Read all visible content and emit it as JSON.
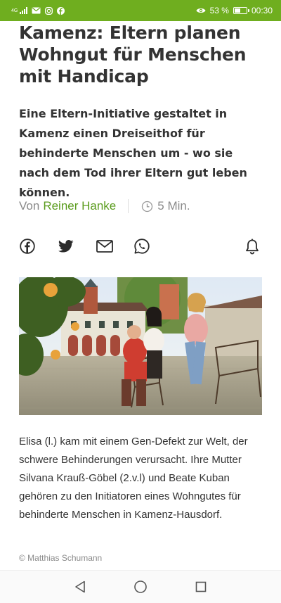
{
  "status_bar": {
    "network": "4G",
    "battery_percent": "53 %",
    "battery_level": 0.53,
    "time": "00:30",
    "icons": [
      "signal-icon",
      "mail-icon",
      "instagram-icon",
      "facebook-icon",
      "eye-icon",
      "battery-icon"
    ]
  },
  "article": {
    "headline": "Kamenz: Eltern planen Wohngut für Menschen mit Handicap",
    "teaser": "Eine Eltern-Initiative gestaltet in Kamenz einen Dreiseithof für behinderte Menschen um - wo sie nach dem Tod ihrer Eltern gut leben können.",
    "byline_prefix": "Von",
    "author": "Reiner Hanke",
    "reading_time": "5 Min.",
    "image_caption": "Elisa (l.) kam mit einem Gen-Defekt zur Welt, der schwere Behinderungen verursacht. Ihre Mutter Silvana Krauß-Göbel (2.v.l) und Beate Kuban gehören zu den Initiatoren eines Wohngutes für behinderte Menschen in Kamenz-Hausdorf.",
    "photo_credit": "© Matthias Schumann"
  },
  "share": {
    "icons": [
      "facebook-icon",
      "twitter-icon",
      "mail-icon",
      "whatsapp-icon",
      "bell-icon"
    ]
  },
  "nav_bar": {
    "icons": [
      "back-icon",
      "home-icon",
      "recent-apps-icon"
    ]
  },
  "colors": {
    "status_bar": "#6fae1f",
    "author_link": "#5b9c1e",
    "text": "#333333",
    "muted": "#8a8a8a"
  }
}
